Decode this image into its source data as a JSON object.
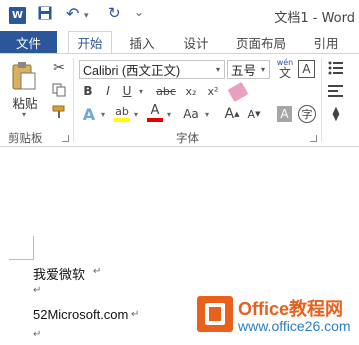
{
  "title_bar": {
    "app_icon_text": "W",
    "undo_icon": "↶",
    "redo_icon": "↻",
    "more_icon": "⌄",
    "title": "文档1 - Word"
  },
  "tabs": [
    {
      "label": "文件"
    },
    {
      "label": "开始"
    },
    {
      "label": "插入"
    },
    {
      "label": "设计"
    },
    {
      "label": "页面布局"
    },
    {
      "label": "引用"
    }
  ],
  "ribbon": {
    "clipboard": {
      "paste_label": "粘贴",
      "group_label": "剪贴板"
    },
    "font": {
      "font_name": "Calibri (西文正文)",
      "font_size": "五号",
      "group_label": "字体",
      "wen_label": "wén",
      "wen_char": "文",
      "bold": "B",
      "italic": "I",
      "underline": "U",
      "strike": "abc",
      "subscript": "x₂",
      "superscript": "x²",
      "change_case": "Aa",
      "grow": "A",
      "shrink": "A",
      "char_shading": "A",
      "enclose": "字"
    },
    "colors": {
      "accent": "#2b579a",
      "highlight": "#ffff00",
      "font_color": "#e00000"
    }
  },
  "document": {
    "para_mark": "↵",
    "line1": "我爱微软",
    "line2": "52Microsoft.com"
  },
  "watermark": {
    "brand_main": "Office教程网",
    "brand_url": "www.office26.com"
  }
}
